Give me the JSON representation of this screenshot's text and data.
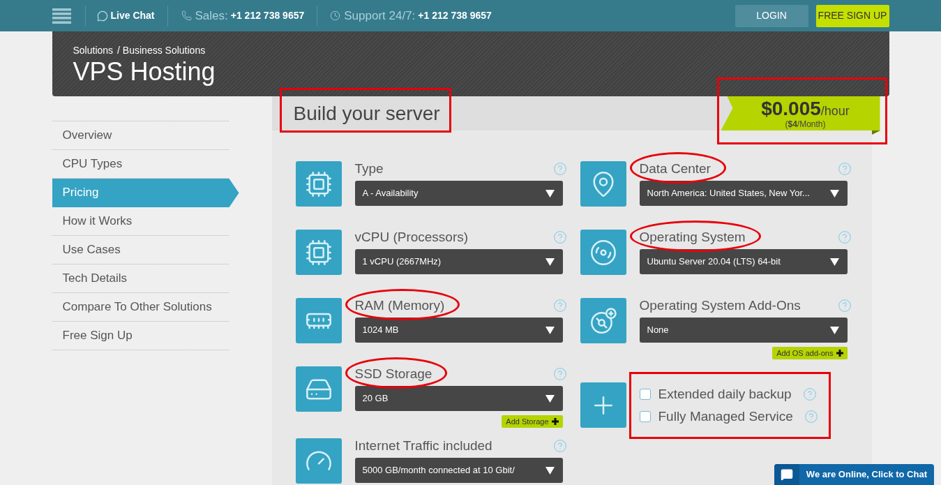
{
  "top_bar": {
    "live_chat": "Live Chat",
    "sales": {
      "label": "Sales:",
      "phone": "+1 212 738 9657"
    },
    "support": {
      "label": "Support 24/7:",
      "phone": "+1 212 738 9657"
    },
    "buttons": [
      {
        "label": "LOGIN",
        "kind": "secondary"
      },
      {
        "label": "FREE SIGN UP",
        "kind": "primary"
      }
    ]
  },
  "header": {
    "breadcrumb": [
      "Solutions",
      "/ Business Solutions"
    ],
    "title": "VPS Hosting"
  },
  "sidebar": {
    "items": [
      {
        "label": "Overview",
        "selected": false
      },
      {
        "label": "CPU Types",
        "selected": false
      },
      {
        "label": "Pricing",
        "selected": true
      },
      {
        "label": "How it Works",
        "selected": false
      },
      {
        "label": "Use Cases",
        "selected": false
      },
      {
        "label": "Tech Details",
        "selected": false
      },
      {
        "label": "Compare To Other Solutions",
        "selected": false
      },
      {
        "label": "Free Sign Up",
        "selected": false
      }
    ]
  },
  "builder": {
    "title": {
      "text": "Build your server",
      "highlighted": true
    },
    "price": {
      "amount": "$0.005",
      "unit": "/hour",
      "monthly": "(**$4**/Month)",
      "highlighted": true
    },
    "left_column": [
      {
        "kind": "select",
        "label": "Type",
        "value": "A - Availability",
        "highlighted": false
      },
      {
        "kind": "select",
        "label": "vCPU (Processors)",
        "value": "1 vCPU (2667MHz)",
        "highlighted": false
      },
      {
        "kind": "select",
        "label": "RAM (Memory)",
        "value": "1024 MB",
        "highlighted": true
      },
      {
        "kind": "select",
        "label": "SSD Storage",
        "value": "20 GB",
        "highlighted": true,
        "add_button": "Add Storage"
      },
      {
        "kind": "select",
        "label": "Internet Traffic included",
        "value": "5000 GB/month connected at 10 Gbit/",
        "highlighted": false
      }
    ],
    "right_column": [
      {
        "kind": "select",
        "label": "Data Center",
        "value": "North America: United States, New Yor...",
        "highlighted": true
      },
      {
        "kind": "select",
        "label": "Operating System",
        "value": "Ubuntu Server 20.04 (LTS) 64-bit",
        "highlighted": true
      },
      {
        "kind": "select",
        "label": "Operating System Add-Ons",
        "value": "None",
        "highlighted": false,
        "add_button": "Add OS add-ons"
      },
      {
        "kind": "checklist",
        "highlighted": true,
        "options": [
          {
            "label": "Extended daily backup",
            "checked": false
          },
          {
            "label": "Fully Managed Service",
            "checked": false
          }
        ]
      }
    ]
  },
  "chat_widget": {
    "text": "We are Online, Click to Chat"
  }
}
